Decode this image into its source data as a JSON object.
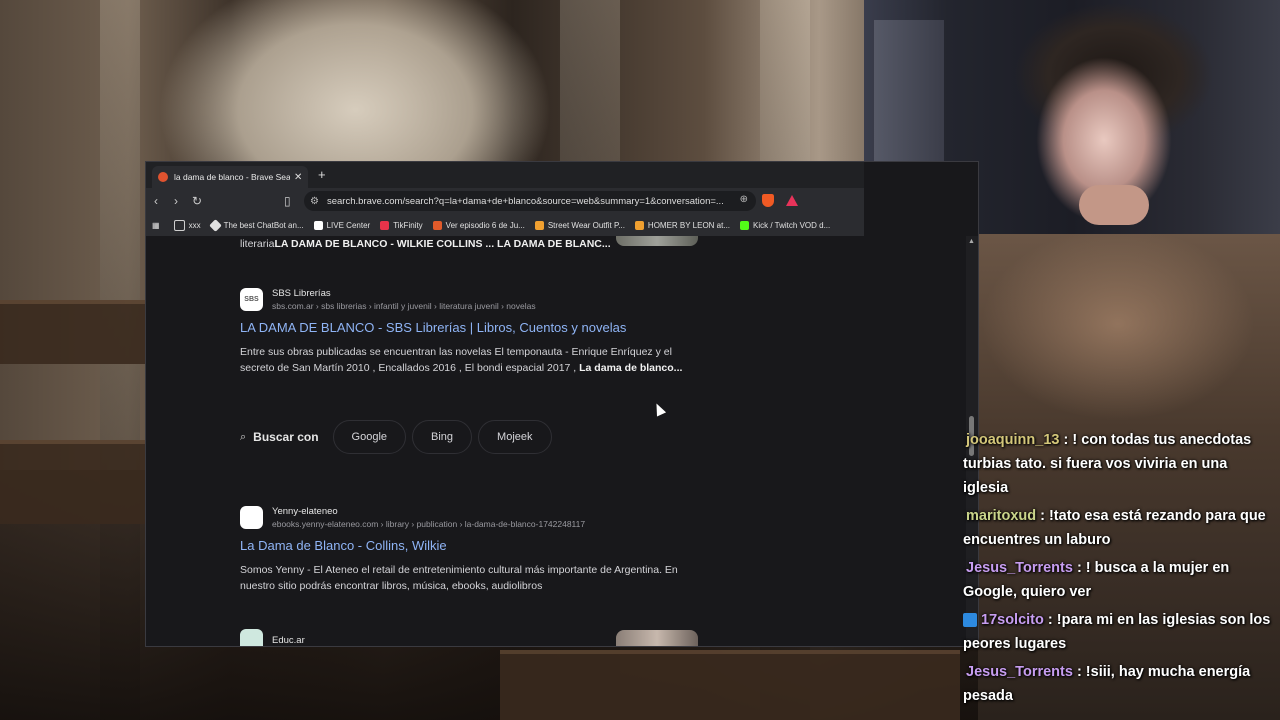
{
  "browser": {
    "tab_title": "la dama de blanco - Brave Search",
    "tab_close": "✕",
    "new_tab": "+",
    "url": "search.brave.com/search?q=la+dama+de+blanco&source=web&summary=1&conversation=...",
    "bookmarks": [
      {
        "label": "xxx",
        "icon": "folder-icon",
        "color": "#cfcfcf"
      },
      {
        "label": "The best ChatBot an...",
        "icon": "chatbot-icon",
        "color": "#e0e0e0"
      },
      {
        "label": "LIVE Center",
        "icon": "tiktok-icon",
        "color": "#ffffff"
      },
      {
        "label": "TikFinity",
        "icon": "tikfinity-icon",
        "color": "#e8334a"
      },
      {
        "label": "Ver episodio 6 de Ju...",
        "icon": "episode-icon",
        "color": "#e05a2a"
      },
      {
        "label": "Street Wear Outfit P...",
        "icon": "pinterest-icon",
        "color": "#f0a030"
      },
      {
        "label": "HOMER BY LEON at...",
        "icon": "shop-icon",
        "color": "#f0a030"
      },
      {
        "label": "Kick / Twitch VOD d...",
        "icon": "kick-icon",
        "color": "#53fc18"
      }
    ]
  },
  "results": {
    "top_snippet_prefix": "literaria",
    "top_snippet_bold": "LA DAMA DE BLANCO - WILKIE COLLINS ... LA DAMA DE BLANC...",
    "items": [
      {
        "logo": "SBS",
        "site": "SBS Librerías",
        "url": "sbs.com.ar › sbs librerias › infantil y juvenil › literatura juvenil › novelas",
        "title": "LA DAMA DE BLANCO - SBS Librerías | Libros, Cuentos y novelas",
        "desc": "Entre sus obras publicadas se encuentran las novelas El temponauta - Enrique Enríquez y el secreto de San Martín 2010 , Encallados 2016 , El bondi espacial 2017 , ",
        "desc_bold": "La dama de blanco..."
      },
      {
        "logo": "",
        "site": "Yenny-elateneo",
        "url": "ebooks.yenny-elateneo.com › library › publication › la-dama-de-blanco-1742248117",
        "title": "La Dama de Blanco - Collins, Wilkie",
        "desc": "Somos Yenny - El Ateneo el retail de entretenimiento cultural más importante de Argentina. En nuestro sitio podrás encontrar libros, música, ebooks, audiolibros",
        "desc_bold": ""
      }
    ],
    "next_site": "Educ.ar",
    "search_with": {
      "label": "Buscar con",
      "engines": [
        "Google",
        "Bing",
        "Mojeek"
      ]
    }
  },
  "chat": [
    {
      "user": "jooaquinn_13",
      "color": "#d4c77a",
      "text": ": ! con todas tus anecdotas turbias tato. si fuera vos viviria en una iglesia",
      "badge": false
    },
    {
      "user": "maritoxud",
      "color": "#c9d48a",
      "text": ": !tato esa está rezando para que encuentres un laburo",
      "badge": false
    },
    {
      "user": "Jesus_Torrents",
      "color": "#c79df0",
      "text": ": ! busca a la mujer en Google, quiero ver",
      "badge": false
    },
    {
      "user": "17solcito",
      "color": "#c79df0",
      "text": ": !para mi en las iglesias son los peores lugares",
      "badge": true
    },
    {
      "user": "Jesus_Torrents",
      "color": "#c79df0",
      "text": ": !siii, hay mucha energía pesada",
      "badge": false
    }
  ]
}
